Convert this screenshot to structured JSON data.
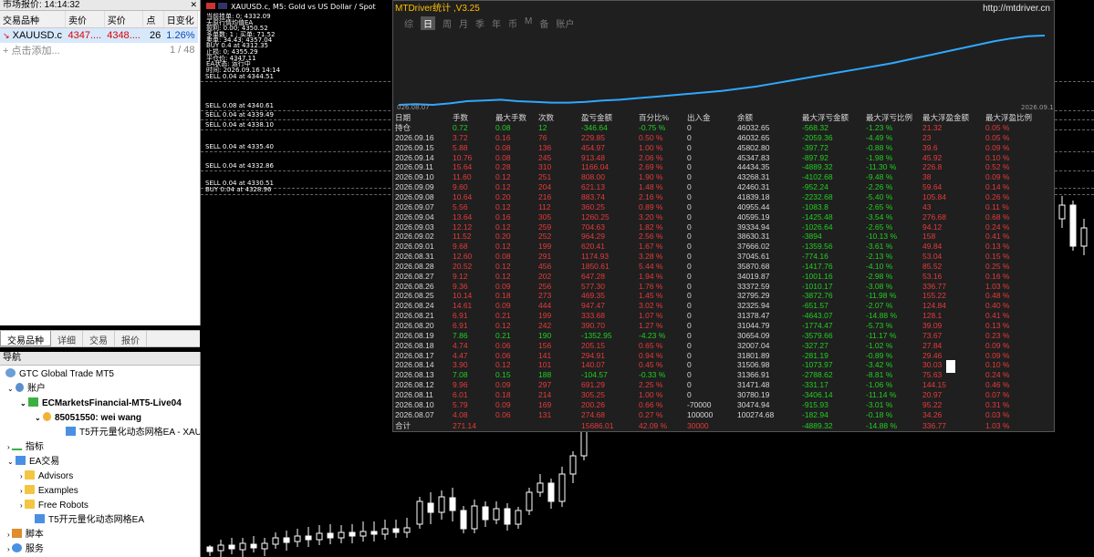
{
  "market_watch": {
    "title": "市场报价: 14:14:32",
    "headers": [
      "交易品种",
      "卖价",
      "买价",
      "点",
      "日变化"
    ],
    "rows": [
      {
        "symbol": "XAUUSD.c",
        "bid": "4347....",
        "ask": "4348....",
        "spread": "26",
        "change": "1.26%"
      }
    ],
    "add_label": "点击添加...",
    "count": "1 / 48",
    "tabs": [
      "交易品种",
      "详细",
      "交易",
      "报价"
    ]
  },
  "navigator": {
    "title": "导航",
    "items": [
      {
        "label": "GTC Global Trade MT5"
      },
      {
        "label": "账户"
      },
      {
        "label": "ECMarketsFinancial-MT5-Live04"
      },
      {
        "label": "85051550: wei wang"
      },
      {
        "label": "T5开元量化动态网格EA - XAUU"
      },
      {
        "label": "指标"
      },
      {
        "label": "EA交易"
      },
      {
        "label": "Advisors"
      },
      {
        "label": "Examples"
      },
      {
        "label": "Free Robots"
      },
      {
        "label": "T5开元量化动态网格EA"
      },
      {
        "label": "脚本"
      },
      {
        "label": "服务"
      }
    ]
  },
  "chart": {
    "symbol_title": "XAUUSD.c, M5:  Gold vs US Dollar / Spot",
    "overlay_lines": [
      "当前挂单: 0; 4332.09",
      "天原行情均值EA",
      "盈利: 0.00; 4350.52",
      "多单数: 1 ; 买单: 71.52",
      "卖单: 34.43; 4357.04",
      "BUY 0.4 at 4312.35",
      "止损: 0; 4355.29",
      "平仓价: 4347.11",
      "EA状态: 运行中",
      "时间: 2026.09.16 14:14"
    ],
    "order_labels": [
      "SELL 0.04 at 4344.51",
      "SELL 0.08 at 4340.61",
      "SELL 0.04 at 4339.49",
      "SELL 0.04 at 4338.10",
      "SELL 0.04 at 4335.40",
      "SELL 0.04 at 4332.86",
      "SELL 0.04 at 4330.51",
      "BUY 0.04 at 4328.96"
    ]
  },
  "stats_panel": {
    "title": "MTDriver统计 ,V3.25",
    "url": "http://mtdriver.cn",
    "tabs": [
      "综",
      "日",
      "周",
      "月",
      "季",
      "年",
      "币",
      "M",
      "备",
      "账户"
    ],
    "active_tab": "日",
    "equity_start_label": "026.08.07",
    "equity_end_label": "2026.09.16",
    "equity_points": [
      0.05,
      0.06,
      0.05,
      0.07,
      0.1,
      0.11,
      0.12,
      0.1,
      0.09,
      0.08,
      0.08,
      0.09,
      0.11,
      0.12,
      0.14,
      0.16,
      0.18,
      0.2,
      0.22,
      0.24,
      0.27,
      0.3,
      0.34,
      0.38,
      0.42,
      0.46,
      0.5,
      0.54,
      0.58,
      0.62,
      0.67,
      0.72,
      0.77,
      0.82,
      0.87,
      0.92,
      0.96,
      0.99,
      1.0
    ],
    "headers": [
      "日期",
      "手数",
      "最大手数",
      "次数",
      "盈亏金额",
      "百分比%",
      "出入金",
      "余额",
      "最大浮亏金额",
      "最大浮亏比例",
      "最大浮盈金额",
      "最大浮盈比例"
    ],
    "rows": [
      [
        "持仓",
        "0.72",
        "0.08",
        "12",
        "-346.64",
        "-0.75 %",
        "0",
        "46032.65",
        "-568.32",
        "-1.23 %",
        "21.32",
        "0.05 %"
      ],
      [
        "2026.09.16",
        "3.72",
        "0.16",
        "76",
        "229.85",
        "0.50 %",
        "0",
        "46032.65",
        "-2059.36",
        "-4.49 %",
        "23",
        "0.05 %"
      ],
      [
        "2026.09.15",
        "5.88",
        "0.08",
        "136",
        "454.97",
        "1.00 %",
        "0",
        "45802.80",
        "-397.72",
        "-0.88 %",
        "39.6",
        "0.09 %"
      ],
      [
        "2026.09.14",
        "10.76",
        "0.08",
        "245",
        "913.48",
        "2.06 %",
        "0",
        "45347.83",
        "-897.92",
        "-1.98 %",
        "45.92",
        "0.10 %"
      ],
      [
        "2026.09.11",
        "15.64",
        "0.28",
        "310",
        "1166.04",
        "2.69 %",
        "0",
        "44434.35",
        "-4889.32",
        "-11.30 %",
        "226.8",
        "0.52 %"
      ],
      [
        "2026.09.10",
        "11.60",
        "0.12",
        "251",
        "808.00",
        "1.90 %",
        "0",
        "43268.31",
        "-4102.68",
        "-9.48 %",
        "38",
        "0.09 %"
      ],
      [
        "2026.09.09",
        "9.60",
        "0.12",
        "204",
        "621.13",
        "1.48 %",
        "0",
        "42460.31",
        "-952.24",
        "-2.26 %",
        "59.64",
        "0.14 %"
      ],
      [
        "2026.09.08",
        "10.64",
        "0.20",
        "216",
        "883.74",
        "2.16 %",
        "0",
        "41839.18",
        "-2232.68",
        "-5.40 %",
        "105.84",
        "0.26 %"
      ],
      [
        "2026.09.07",
        "5.56",
        "0.12",
        "112",
        "360.25",
        "0.89 %",
        "0",
        "40955.44",
        "-1083.8",
        "-2.65 %",
        "43",
        "0.11 %"
      ],
      [
        "2026.09.04",
        "13.64",
        "0.16",
        "305",
        "1260.25",
        "3.20 %",
        "0",
        "40595.19",
        "-1425.48",
        "-3.54 %",
        "276.68",
        "0.68 %"
      ],
      [
        "2026.09.03",
        "12.12",
        "0.12",
        "259",
        "704.63",
        "1.82 %",
        "0",
        "39334.94",
        "-1026.64",
        "-2.65 %",
        "94.12",
        "0.24 %"
      ],
      [
        "2026.09.02",
        "11.52",
        "0.20",
        "252",
        "964.29",
        "2.56 %",
        "0",
        "38630.31",
        "-3894",
        "-10.13 %",
        "158",
        "0.41 %"
      ],
      [
        "2026.09.01",
        "9.68",
        "0.12",
        "199",
        "620.41",
        "1.67 %",
        "0",
        "37666.02",
        "-1359.56",
        "-3.61 %",
        "49.84",
        "0.13 %"
      ],
      [
        "2026.08.31",
        "12.60",
        "0.08",
        "291",
        "1174.93",
        "3.28 %",
        "0",
        "37045.61",
        "-774.16",
        "-2.13 %",
        "53.04",
        "0.15 %"
      ],
      [
        "2026.08.28",
        "20.52",
        "0.12",
        "456",
        "1850.61",
        "5.44 %",
        "0",
        "35870.68",
        "-1417.76",
        "-4.10 %",
        "85.52",
        "0.25 %"
      ],
      [
        "2026.08.27",
        "9.12",
        "0.12",
        "202",
        "647.28",
        "1.94 %",
        "0",
        "34019.87",
        "-1001.16",
        "-2.98 %",
        "53.16",
        "0.16 %"
      ],
      [
        "2026.08.26",
        "9.36",
        "0.09",
        "256",
        "577.30",
        "1.76 %",
        "0",
        "33372.59",
        "-1010.17",
        "-3.08 %",
        "336.77",
        "1.03 %"
      ],
      [
        "2026.08.25",
        "10.14",
        "0.18",
        "273",
        "469.35",
        "1.45 %",
        "0",
        "32795.29",
        "-3872.76",
        "-11.98 %",
        "155.22",
        "0.48 %"
      ],
      [
        "2026.08.24",
        "14.61",
        "0.09",
        "444",
        "947.47",
        "3.02 %",
        "0",
        "32325.94",
        "-651.57",
        "-2.07 %",
        "124.84",
        "0.40 %"
      ],
      [
        "2026.08.21",
        "6.91",
        "0.21",
        "199",
        "333.68",
        "1.07 %",
        "0",
        "31378.47",
        "-4643.07",
        "-14.88 %",
        "128.1",
        "0.41 %"
      ],
      [
        "2026.08.20",
        "6.91",
        "0.12",
        "242",
        "390.70",
        "1.27 %",
        "0",
        "31044.79",
        "-1774.47",
        "-5.73 %",
        "39.09",
        "0.13 %"
      ],
      [
        "2026.08.19",
        "7.86",
        "0.21",
        "190",
        "-1352.95",
        "-4.23 %",
        "0",
        "30654.09",
        "-3579.66",
        "-11.17 %",
        "73.67",
        "0.23 %"
      ],
      [
        "2026.08.18",
        "4.74",
        "0.06",
        "156",
        "205.15",
        "0.65 %",
        "0",
        "32007.04",
        "-327.27",
        "-1.02 %",
        "27.84",
        "0.09 %"
      ],
      [
        "2026.08.17",
        "4.47",
        "0.06",
        "141",
        "294.91",
        "0.94 %",
        "0",
        "31801.89",
        "-281.19",
        "-0.89 %",
        "29.46",
        "0.09 %"
      ],
      [
        "2026.08.14",
        "3.90",
        "0.12",
        "101",
        "140.07",
        "0.45 %",
        "0",
        "31506.98",
        "-1073.97",
        "-3.42 %",
        "30.03",
        "0.10 %"
      ],
      [
        "2026.08.13",
        "7.08",
        "0.15",
        "188",
        "-104.57",
        "-0.33 %",
        "0",
        "31366.91",
        "-2788.62",
        "-8.81 %",
        "75.63",
        "0.24 %"
      ],
      [
        "2026.08.12",
        "9.96",
        "0.09",
        "297",
        "691.29",
        "2.25 %",
        "0",
        "31471.48",
        "-331.17",
        "-1.06 %",
        "144.15",
        "0.46 %"
      ],
      [
        "2026.08.11",
        "6.01",
        "0.18",
        "214",
        "305.25",
        "1.00 %",
        "0",
        "30780.19",
        "-3406.14",
        "-11.14 %",
        "20.97",
        "0.07 %"
      ],
      [
        "2026.08.10",
        "5.79",
        "0.09",
        "169",
        "200.26",
        "0.66 %",
        "-70000",
        "30474.94",
        "-915.93",
        "-3.01 %",
        "95.22",
        "0.31 %"
      ],
      [
        "2026.08.07",
        "4.08",
        "0.06",
        "131",
        "274.68",
        "0.27 %",
        "100000",
        "100274.68",
        "-182.94",
        "-0.18 %",
        "34.26",
        "0.03 %"
      ]
    ],
    "total": [
      "合计",
      "271.14",
      "",
      "",
      "15686.01",
      "42.09 %",
      "30000",
      "",
      "-4889.32",
      "-14.88 %",
      "336.77",
      "1.03 %"
    ]
  },
  "colors": {
    "accent": "#ffbf00",
    "up": "#20d020",
    "down": "#e83a3a",
    "equity": "#2fa8ff"
  }
}
